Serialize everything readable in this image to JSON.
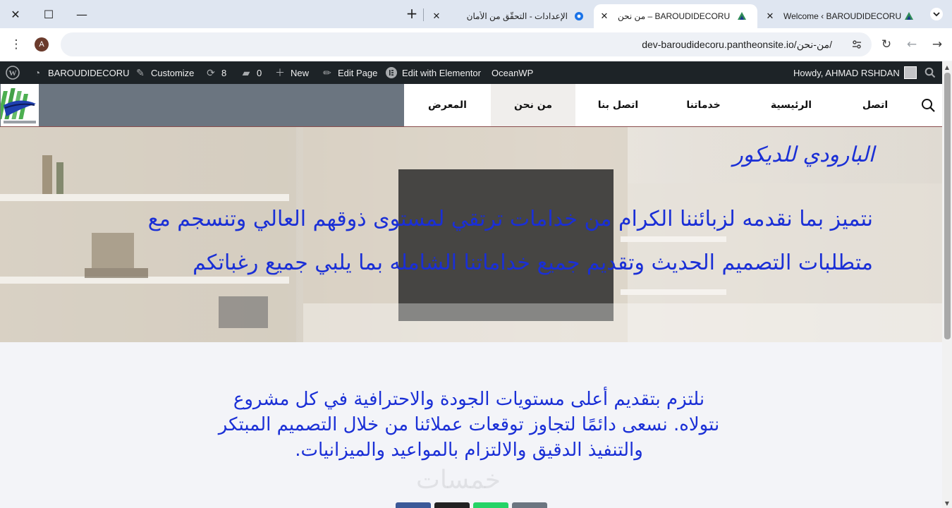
{
  "browser": {
    "tabs": [
      {
        "title": "Welcome ‹ BAROUDIDECORU — ",
        "favicon": "site-logo-icon",
        "active": false
      },
      {
        "title": "من نحن – BAROUDIDECORU",
        "favicon": "site-logo-icon",
        "active": true
      },
      {
        "title": "الإعدادات - التحقّق من الأمان",
        "favicon": "settings-gear-icon",
        "active": false
      }
    ],
    "url": "dev-baroudidecoru.pantheonsite.io/من-نحن/",
    "profile_initial": "A"
  },
  "adminbar": {
    "site_name": "BAROUDIDECORU",
    "customize": "Customize",
    "updates_count": "8",
    "comments_count": "0",
    "new": "New",
    "edit_page": "Edit Page",
    "edit_elementor": "Edit with Elementor",
    "oceanwp": "OceanWP",
    "howdy": "Howdy, AHMAD RSHDAN"
  },
  "nav": {
    "items": [
      "اتصل",
      "الرئيسية",
      "خدماتنا",
      "اتصل بنا",
      "من نحن",
      "المعرض"
    ],
    "active_index": 4
  },
  "hero": {
    "title": "البارودي للديكور",
    "text": "نتميز بما نقدمه لزبائننا الكرام من خدامات ترتقي لمستوى ذوقهم العالي وتنسجم مع متطلبات التصميم الحديث وتقديم جميع خداماتنا الشامله بما يلبي جميع رغباتكم"
  },
  "mission": {
    "text": "نلتزم بتقديم أعلى مستويات الجودة والاحترافية في كل مشروع نتولاه. نسعى دائمًا لتجاوز توقعات عملائنا من خلال التصميم المبتكر والتنفيذ الدقيق والالتزام بالمواعيد والميزانيات."
  },
  "watermark": "خمسات",
  "colors": {
    "heading_blue": "#1a2fd6",
    "header_gray": "#6b7580",
    "adminbar": "#1d2327",
    "share_buttons": [
      "#3b5998",
      "#222222",
      "#25d366",
      "#6b7580"
    ]
  }
}
